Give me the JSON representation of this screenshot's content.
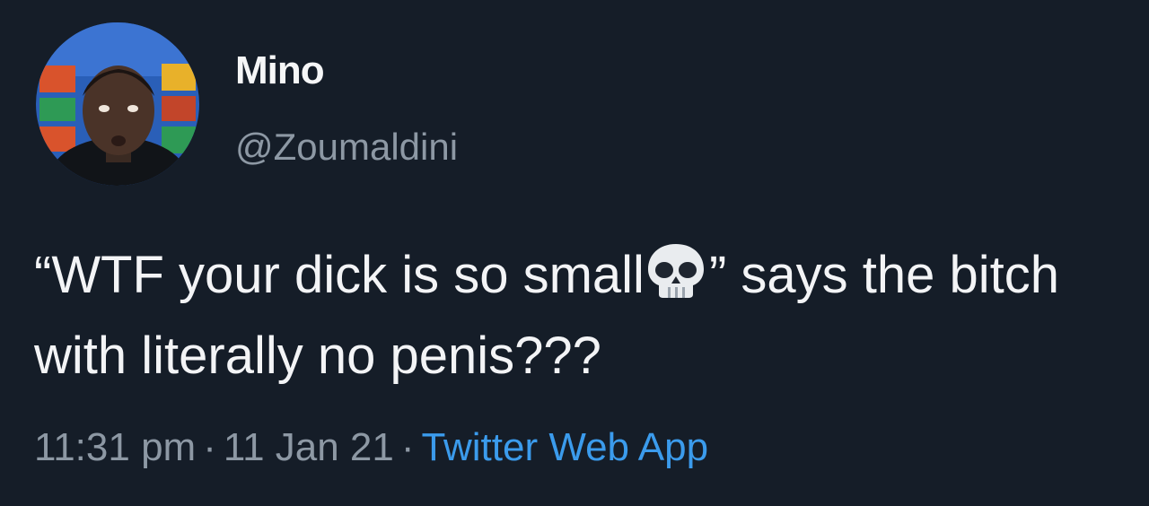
{
  "user": {
    "display_name": "Mino",
    "handle": "@Zoumaldini",
    "avatar_icon": "profile-photo"
  },
  "tweet": {
    "text_before_emoji": "“WTF your dick is so small",
    "emoji_icon": "skull-icon",
    "text_after_emoji": "” says the bitch with literally no penis???"
  },
  "meta": {
    "time": "11:31 pm",
    "separator": "·",
    "date": "11 Jan 21",
    "source": "Twitter Web App"
  },
  "colors": {
    "background": "#151d28",
    "text_primary": "#f3f4f6",
    "text_secondary": "#8d98a4",
    "link": "#3b9bec"
  }
}
